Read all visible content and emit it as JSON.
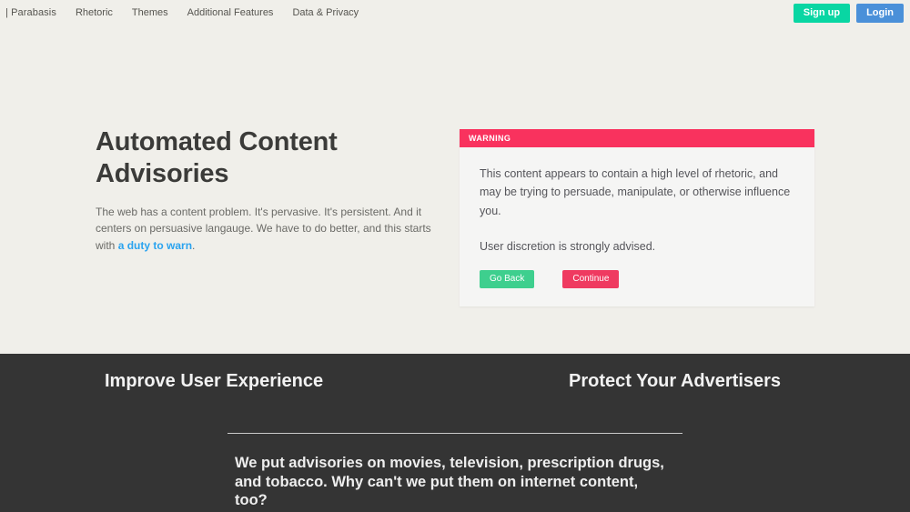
{
  "nav": {
    "brand": "| Parabasis",
    "items": [
      {
        "label": "Rhetoric"
      },
      {
        "label": "Themes"
      },
      {
        "label": "Additional Features"
      },
      {
        "label": "Data & Privacy"
      }
    ],
    "signup_label": "Sign up",
    "login_label": "Login"
  },
  "hero": {
    "title": "Automated Content Advisories",
    "paragraph_before": "The web has a content problem. It's pervasive. It's persistent. And it centers on persuasive langauge. We have to do better, and this starts with ",
    "paragraph_link": "a duty to warn",
    "paragraph_after": "."
  },
  "warning": {
    "header_label": "WARNING",
    "body_line_1": "This content appears to contain a high level of rhetoric, and may be trying to persuade, manipulate, or otherwise influence you.",
    "body_line_2": "User discretion is strongly advised.",
    "go_back_label": "Go Back",
    "continue_label": "Continue"
  },
  "features": {
    "heading_left": "Improve User Experience",
    "heading_right": "Protect Your Advertisers",
    "body": "We put advisories on movies, television, prescription drugs, and tobacco. Why can't we put them on internet content, too?"
  },
  "colors": {
    "page_background": "#f0efea",
    "dark_section": "#343434",
    "warning_accent": "#f9325e",
    "signup_green": "#09d6a3",
    "login_blue": "#4a90d9",
    "goback_green": "#3ecf8e",
    "continue_red": "#ef3a60",
    "link_blue": "#2aa3ef"
  }
}
